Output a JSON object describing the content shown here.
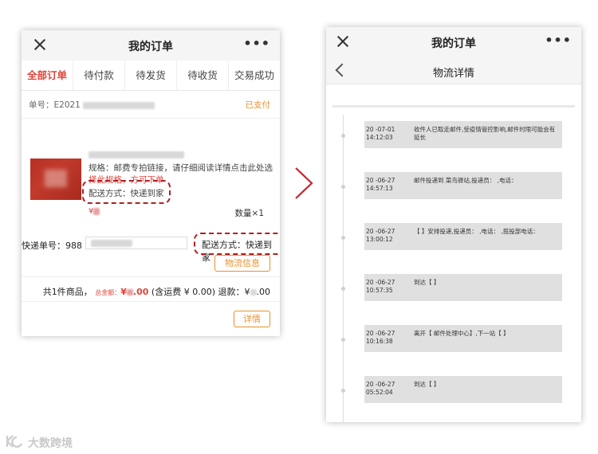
{
  "left_screen": {
    "title": "我的订单",
    "tabs": [
      "全部订单",
      "待付款",
      "待发货",
      "待收货",
      "交易成功"
    ],
    "order_number_label": "单号：E2021",
    "order_status": "已支付",
    "spec_line1": "规格：邮费专拍链接，请仔细阅读详情点击此处选",
    "spec_line2": "择此规格，方可下单",
    "delivery_method": "配送方式：快递到家",
    "price_mark": "¥",
    "quantity": "数量×1",
    "tracking_label": "快递单号：988",
    "delivery_method_2": "配送方式：快递到家",
    "logistics_button": "物流信息",
    "summary": {
      "items": "共1件商品，",
      "total_label": "总金额：",
      "total_prefix": "¥",
      "total_suffix": ".00",
      "shipping": "(含运费 ¥ 0.00)",
      "refund_label": "退款：¥",
      "refund_suffix": ".00"
    },
    "detail_button": "详情"
  },
  "right_screen": {
    "title": "我的订单",
    "subtitle": "物流详情",
    "events": [
      {
        "date": "20 -07-01",
        "time": "14:12:03",
        "text": "收件人已取走邮件,受疫情管控影响,邮件时限可能会有延长"
      },
      {
        "date": "20 -06-27",
        "time": "14:57:13",
        "text": "邮件投递到 菜鸟驿站,投递员： ,电话： "
      },
      {
        "date": "20 -06-27",
        "time": "13:00:12",
        "text": "【 】安排投递,投递员： ,电话： ,揽投部电话： "
      },
      {
        "date": "20 -06-27",
        "time": "10:57:35",
        "text": "到达【 】"
      },
      {
        "date": "20 -06-27",
        "time": "10:16:38",
        "text": "离开【 邮件处理中心】,下一站【 】"
      },
      {
        "date": "20 -06-27",
        "time": "05:52:04",
        "text": "到达【 】"
      }
    ]
  },
  "watermark": "大数跨境",
  "colors": {
    "accent_red": "#e0423a",
    "accent_orange": "#e8902c",
    "dashed_highlight": "#b11e23",
    "event_bg": "#e0e0e0"
  }
}
